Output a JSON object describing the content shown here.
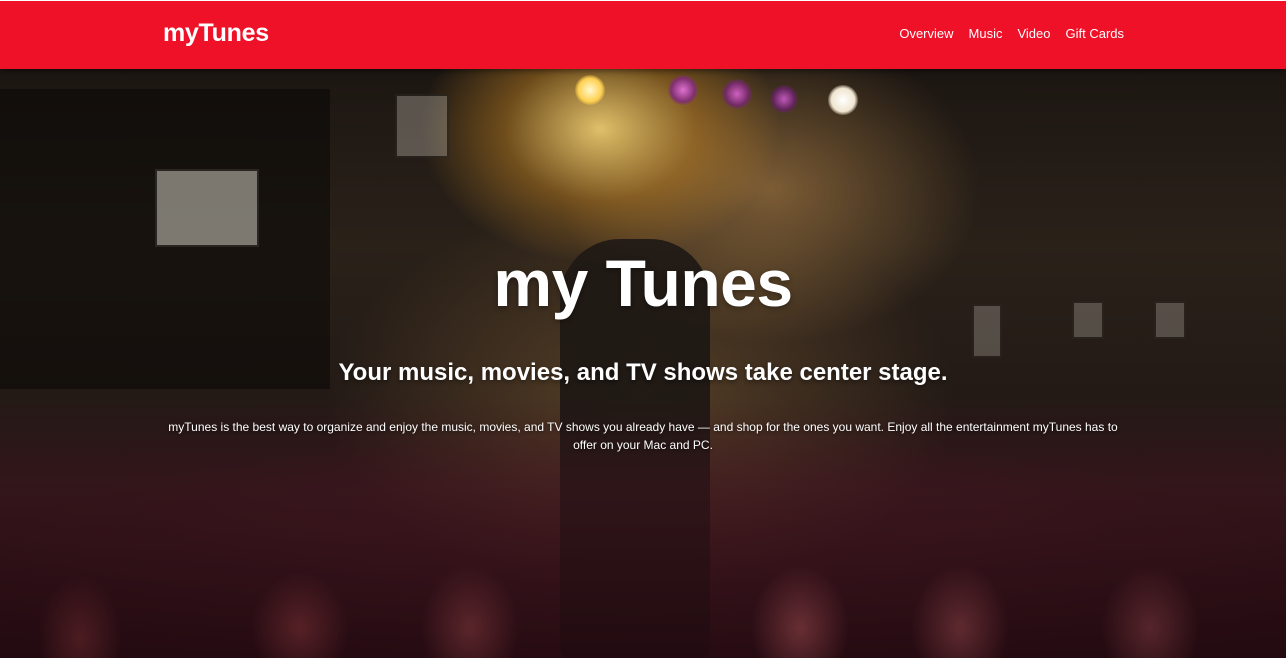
{
  "navbar": {
    "brand": "myTunes",
    "links": [
      "Overview",
      "Music",
      "Video",
      "Gift Cards"
    ]
  },
  "hero": {
    "title": "my Tunes",
    "subtitle": "Your music, movies, and TV shows take center stage.",
    "body": "myTunes is the best way to organize and enjoy the music, movies, and TV shows you already have — and shop for the ones you want. Enjoy all the entertainment myTunes has to offer on your Mac and PC."
  },
  "colors": {
    "navbar_bg": "#ee1128",
    "text": "#ffffff"
  }
}
